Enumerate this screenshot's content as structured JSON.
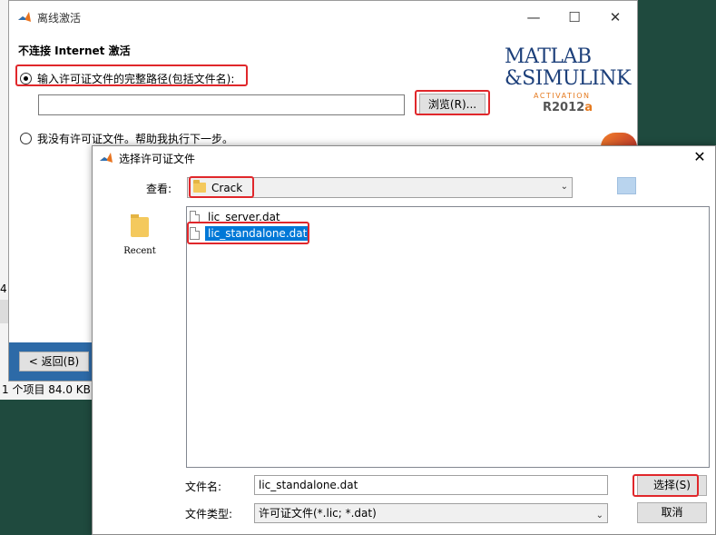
{
  "background": {
    "left_digit": "4",
    "status_text": "1 个项目  84.0 KB"
  },
  "activation_window": {
    "title": "离线激活",
    "heading": "不连接 Internet 激活",
    "option1_label": "输入许可证文件的完整路径(包括文件名):",
    "path_value": "",
    "browse_label": "浏览(R)...",
    "option2_label": "我没有许可证文件。帮助我执行下一步。",
    "back_label": "< 返回(B)",
    "logo": {
      "line1": "MATLAB",
      "line2": "&SIMULINK",
      "line3": "ACTIVATION",
      "version_prefix": "R2012",
      "version_suffix": "a"
    },
    "minimize_symbol": "—",
    "maximize_symbol": "☐",
    "close_symbol": "✕"
  },
  "file_dialog": {
    "title": "选择许可证文件",
    "lookin_label": "查看:",
    "lookin_value": "Crack",
    "recent_label": "Recent",
    "files": [
      {
        "name": "lic_server.dat",
        "selected": false
      },
      {
        "name": "lic_standalone.dat",
        "selected": true
      }
    ],
    "filename_label": "文件名:",
    "filename_value": "lic_standalone.dat",
    "filetype_label": "文件类型:",
    "filetype_value": "许可证文件(*.lic; *.dat)",
    "select_label": "选择(S)",
    "cancel_label": "取消",
    "close_symbol": "✕"
  },
  "colors": {
    "highlight": "#e0272b",
    "selection": "#0078d7",
    "desktop": "#1f4a3e"
  }
}
